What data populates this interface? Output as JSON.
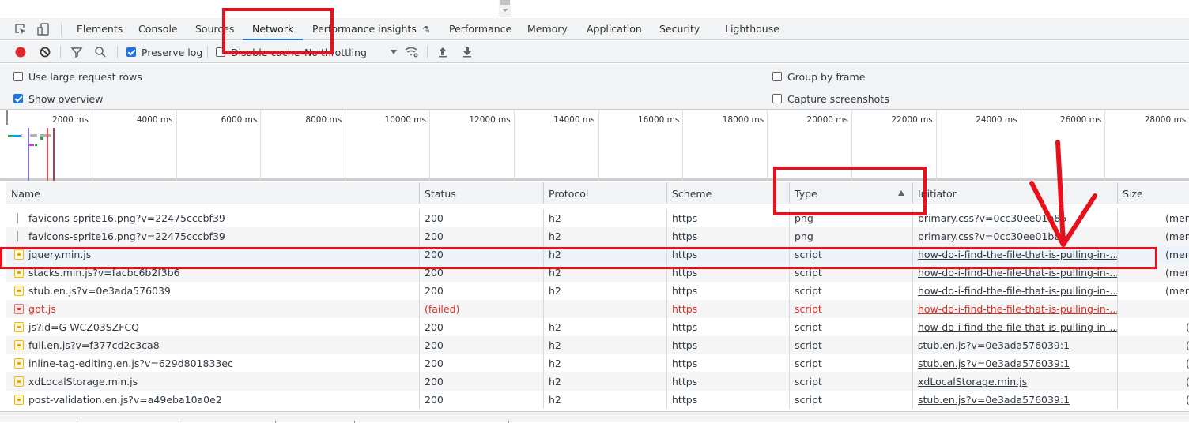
{
  "devtools": {
    "tabs": [
      {
        "label": "Elements",
        "active": false
      },
      {
        "label": "Console",
        "active": false
      },
      {
        "label": "Sources",
        "active": false
      },
      {
        "label": "Network",
        "active": true
      },
      {
        "label": "Performance insights",
        "active": false,
        "icon": "flask-icon"
      },
      {
        "label": "Performance",
        "active": false
      },
      {
        "label": "Memory",
        "active": false
      },
      {
        "label": "Application",
        "active": false
      },
      {
        "label": "Security",
        "active": false
      },
      {
        "label": "Lighthouse",
        "active": false
      }
    ],
    "icons": {
      "inspect": "inspect-element-icon",
      "device": "device-toolbar-icon",
      "flask": "⚗"
    }
  },
  "toolbar": {
    "record": "record-icon",
    "clear": "clear-icon",
    "filter": "filter-icon",
    "search": "search-icon",
    "preserve_log": {
      "label": "Preserve log",
      "checked": true
    },
    "disable_cache": {
      "label": "Disable cache",
      "checked": false
    },
    "throttling": {
      "value": "No throttling"
    },
    "network_conditions": "network-conditions-icon",
    "import": "import-har-icon",
    "export": "export-har-icon"
  },
  "settings": {
    "use_large_rows": {
      "label": "Use large request rows",
      "checked": false
    },
    "show_overview": {
      "label": "Show overview",
      "checked": true
    },
    "group_by_frame": {
      "label": "Group by frame",
      "checked": false
    },
    "capture_screenshots": {
      "label": "Capture screenshots",
      "checked": false
    }
  },
  "overview": {
    "ticks": [
      "2000 ms",
      "4000 ms",
      "6000 ms",
      "8000 ms",
      "10000 ms",
      "12000 ms",
      "14000 ms",
      "16000 ms",
      "18000 ms",
      "20000 ms",
      "22000 ms",
      "24000 ms",
      "26000 ms",
      "28000 ms"
    ],
    "colors": {
      "dcl": "#7a76d6",
      "load": "#e34c4c",
      "load2": "#a43e5c",
      "waiting": "#00a3e0",
      "download": "#1fab3f",
      "queue": "#b0b0b0",
      "other": "#c341d8"
    }
  },
  "table": {
    "columns": [
      {
        "label": "Name"
      },
      {
        "label": "Status"
      },
      {
        "label": "Protocol"
      },
      {
        "label": "Scheme"
      },
      {
        "label": "Type",
        "sorted": "ascending"
      },
      {
        "label": "Initiator"
      },
      {
        "label": "Size"
      }
    ],
    "rows": [
      {
        "name": "favicons-sprite16.png?v=22475cccbf39",
        "kind": "image",
        "status": "200",
        "protocol": "h2",
        "scheme": "https",
        "type": "png",
        "initiator": "primary.css?v=0cc30ee01b86",
        "size": "(mem",
        "failed": false,
        "selected": false
      },
      {
        "name": "favicons-sprite16.png?v=22475cccbf39",
        "kind": "image",
        "status": "200",
        "protocol": "h2",
        "scheme": "https",
        "type": "png",
        "initiator": "primary.css?v=0cc30ee01b86",
        "size": "(mem",
        "failed": false,
        "selected": false
      },
      {
        "name": "jquery.min.js",
        "kind": "script",
        "status": "200",
        "protocol": "h2",
        "scheme": "https",
        "type": "script",
        "initiator": "how-do-i-find-the-file-that-is-pulling-in-...",
        "size": "(mem",
        "failed": false,
        "selected": true
      },
      {
        "name": "stacks.min.js?v=facbc6b2f3b6",
        "kind": "script",
        "status": "200",
        "protocol": "h2",
        "scheme": "https",
        "type": "script",
        "initiator": "how-do-i-find-the-file-that-is-pulling-in-...",
        "size": "(mem",
        "failed": false,
        "selected": false
      },
      {
        "name": "stub.en.js?v=0e3ada576039",
        "kind": "script",
        "status": "200",
        "protocol": "h2",
        "scheme": "https",
        "type": "script",
        "initiator": "how-do-i-find-the-file-that-is-pulling-in-...",
        "size": "(mem",
        "failed": false,
        "selected": false
      },
      {
        "name": "gpt.js",
        "kind": "script",
        "status": "(failed)",
        "protocol": "",
        "scheme": "https",
        "type": "script",
        "initiator": "how-do-i-find-the-file-that-is-pulling-in-...",
        "size": "",
        "failed": true,
        "selected": false
      },
      {
        "name": "js?id=G-WCZ03SZFCQ",
        "kind": "script",
        "status": "200",
        "protocol": "h2",
        "scheme": "https",
        "type": "script",
        "initiator": "how-do-i-find-the-file-that-is-pulling-in-...",
        "size": "(c",
        "failed": false,
        "selected": false
      },
      {
        "name": "full.en.js?v=f377cd2c3ca8",
        "kind": "script",
        "status": "200",
        "protocol": "h2",
        "scheme": "https",
        "type": "script",
        "initiator": "stub.en.js?v=0e3ada576039:1",
        "size": "(c",
        "failed": false,
        "selected": false
      },
      {
        "name": "inline-tag-editing.en.js?v=629d801833ec",
        "kind": "script",
        "status": "200",
        "protocol": "h2",
        "scheme": "https",
        "type": "script",
        "initiator": "stub.en.js?v=0e3ada576039:1",
        "size": "(c",
        "failed": false,
        "selected": false
      },
      {
        "name": "xdLocalStorage.min.js",
        "kind": "script",
        "status": "200",
        "protocol": "h2",
        "scheme": "https",
        "type": "script",
        "initiator": "xdLocalStorage.min.js",
        "size": "(c",
        "failed": false,
        "selected": false
      },
      {
        "name": "post-validation.en.js?v=a49eba10a0e2",
        "kind": "script",
        "status": "200",
        "protocol": "h2",
        "scheme": "https",
        "type": "script",
        "initiator": "stub.en.js?v=0e3ada576039:1",
        "size": "(c",
        "failed": false,
        "selected": false
      }
    ]
  },
  "annotations": {
    "color": "#e8101b"
  }
}
